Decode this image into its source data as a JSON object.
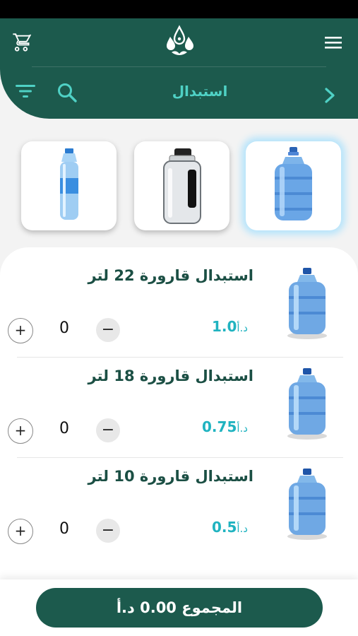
{
  "header": {
    "title": "استبدال",
    "icons": {
      "cart": "shopping-cart-icon",
      "menu": "hamburger-menu-icon",
      "logo": "water-drops-logo",
      "filter": "filter-lines-icon",
      "search": "search-icon",
      "back": "chevron-right-icon"
    }
  },
  "categories": [
    {
      "name": "large-bottle",
      "selected": true
    },
    {
      "name": "gallon-jug",
      "selected": false
    },
    {
      "name": "small-bottle",
      "selected": false
    }
  ],
  "items": [
    {
      "title": "استبدال قارورة 22 لتر",
      "price": "1.0",
      "currency": "د.أ",
      "qty": "0",
      "minus": "−",
      "plus": "+"
    },
    {
      "title": "استبدال قارورة 18 لتر",
      "price": "0.75",
      "currency": "د.أ",
      "qty": "0",
      "minus": "−",
      "plus": "+"
    },
    {
      "title": "استبدال قارورة 10 لتر",
      "price": "0.5",
      "currency": "د.أ",
      "qty": "0",
      "minus": "−",
      "plus": "+"
    }
  ],
  "footer": {
    "total_label": "المجموع 0.00 د.أ"
  },
  "colors": {
    "primary": "#1c5a4d",
    "accent": "#4fd1c5",
    "price": "#20b3c0",
    "title": "#1b4f44"
  }
}
